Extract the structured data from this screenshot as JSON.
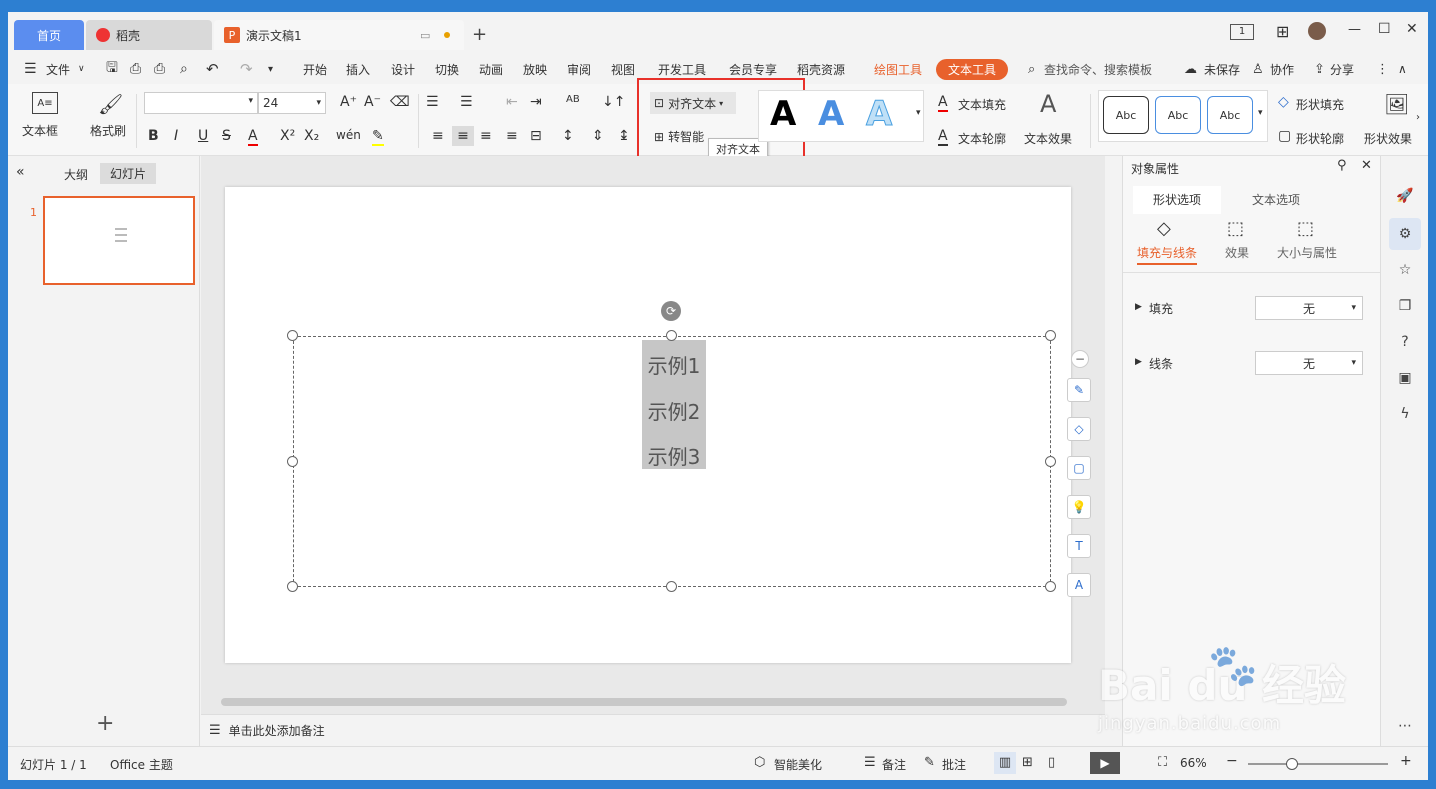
{
  "tabs": {
    "home": "首页",
    "daoke": "稻壳",
    "doc": "演示文稿1",
    "add": "+"
  },
  "titlebar": {
    "layout_icon": "1",
    "minimize": "—",
    "maximize": "☐",
    "close": "✕"
  },
  "menu": {
    "file": "文件",
    "items": [
      "开始",
      "插入",
      "设计",
      "切换",
      "动画",
      "放映",
      "审阅",
      "视图",
      "开发工具",
      "会员专享",
      "稻壳资源"
    ],
    "drawing_tools": "绘图工具",
    "text_tools": "文本工具",
    "search": "查找命令、搜索模板",
    "unsaved": "未保存",
    "collab": "协作",
    "share": "分享"
  },
  "ribbon": {
    "textbox": "文本框",
    "format_painter": "格式刷",
    "font_size": "24",
    "align_text": "对齐文本",
    "to_smartart": "转智能",
    "tooltip": "对齐文本",
    "text_fill": "文本填充",
    "text_outline": "文本轮廓",
    "text_effect": "文本效果",
    "abc": "Abc",
    "shape_fill": "形状填充",
    "shape_outline": "形状轮廓",
    "shape_effect": "形状效果",
    "accent_color": "#e8612c"
  },
  "left_panel": {
    "outline": "大纲",
    "slides": "幻灯片",
    "slide_num": "1"
  },
  "slide": {
    "lines": [
      "示例1",
      "示例2",
      "示例3"
    ]
  },
  "notes": "单击此处添加备注",
  "right_panel": {
    "title": "对象属性",
    "tab_shape": "形状选项",
    "tab_text": "文本选项",
    "sub_fill": "填充与线条",
    "sub_effect": "效果",
    "sub_size": "大小与属性",
    "fill_label": "填充",
    "fill_value": "无",
    "line_label": "线条",
    "line_value": "无"
  },
  "status": {
    "slide_info": "幻灯片 1 / 1",
    "theme": "Office 主题",
    "beautify": "智能美化",
    "notes": "备注",
    "comments": "批注",
    "zoom": "66%"
  },
  "watermark": {
    "brand": "Bai du 经验",
    "url": "jingyan.baidu.com"
  }
}
